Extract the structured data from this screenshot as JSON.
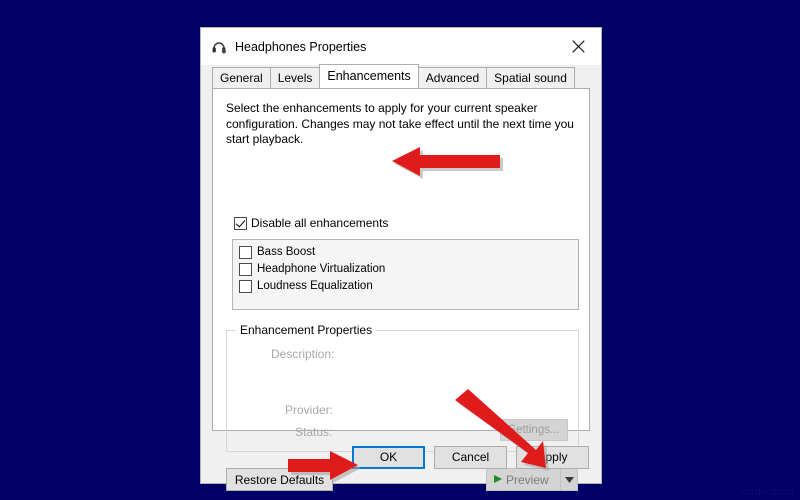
{
  "desktop": {
    "background_color": "#000066",
    "watermark": "wsdn.com"
  },
  "window": {
    "title": "Headphones Properties",
    "title_icon": "headphones-icon",
    "close_icon": "close-icon"
  },
  "tabs": [
    {
      "label": "General",
      "active": false
    },
    {
      "label": "Levels",
      "active": false
    },
    {
      "label": "Enhancements",
      "active": true
    },
    {
      "label": "Advanced",
      "active": false
    },
    {
      "label": "Spatial sound",
      "active": false
    }
  ],
  "panel": {
    "description": "Select the enhancements to apply for your current speaker configuration. Changes may not take effect until the next time you start playback.",
    "disable_all": {
      "label": "Disable all enhancements",
      "checked": true
    },
    "enhancements": [
      {
        "label": "Bass Boost",
        "checked": false
      },
      {
        "label": "Headphone Virtualization",
        "checked": false
      },
      {
        "label": "Loudness Equalization",
        "checked": false
      }
    ],
    "properties_group": {
      "legend": "Enhancement Properties",
      "description_label": "Description:",
      "description_value": "",
      "provider_label": "Provider:",
      "provider_value": "",
      "status_label": "Status:",
      "status_value": "",
      "settings_button": "Settings...",
      "settings_enabled": false
    },
    "restore_defaults_button": "Restore Defaults",
    "preview": {
      "label": "Preview",
      "play_icon": "play-icon",
      "dropdown_icon": "chevron-down-icon",
      "enabled": false
    }
  },
  "buttons": [
    {
      "label": "OK",
      "focused": true
    },
    {
      "label": "Cancel",
      "focused": false
    },
    {
      "label": "Apply",
      "focused": false
    }
  ],
  "annotations": {
    "arrow_color": "#e01b1b",
    "arrow_shadow_color": "#9a9a9a",
    "items": [
      {
        "name": "arrow-to-disable-all-checkbox",
        "direction": "left"
      },
      {
        "name": "arrow-to-apply-button",
        "direction": "down-right"
      },
      {
        "name": "arrow-to-ok-button",
        "direction": "right"
      }
    ]
  }
}
